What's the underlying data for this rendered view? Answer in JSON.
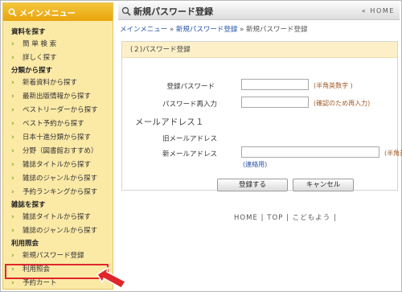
{
  "sidebar": {
    "title": "メインメニュー",
    "sections": [
      {
        "title": "資料を探す",
        "items": [
          "簡 単 検 索",
          "詳しく探す"
        ]
      },
      {
        "title": "分類から探す",
        "items": [
          "新着資料から探す",
          "最新出版情報から探す",
          "ベストリーダーから探す",
          "ベスト予約から探す",
          "日本十進分類から探す",
          "分野（図書館おすすめ）",
          "雑誌タイトルから探す",
          "雑誌のジャンルから探す",
          "予約ランキングから探す"
        ]
      },
      {
        "title": "雑誌を探す",
        "items": [
          "雑誌タイトルから探す",
          "雑誌のジャンルから探す"
        ]
      },
      {
        "title": "利用照会",
        "items": [
          "新規パスワード登録",
          "利用照会",
          "予約カート"
        ]
      }
    ]
  },
  "header": {
    "title": "新規パスワード登録",
    "home_label": "« HOME"
  },
  "breadcrumb": {
    "items": [
      "メインメニュー",
      "新規パスワード登録",
      "新規パスワード登録"
    ],
    "separator": "»"
  },
  "form": {
    "heading": "(２)パスワード登録",
    "password_label": "登録パスワード",
    "password_hint": "(半角英数字 )",
    "password_confirm_label": "パスワード再入力",
    "password_confirm_hint": "(確認のため再入力)",
    "mail_section": "メールアドレス１",
    "old_mail_label": "旧メールアドレス",
    "new_mail_label": "新メールアドレス",
    "new_mail_hint": "(半角英",
    "contact_link": "(連絡用)",
    "submit_button": "登録する",
    "cancel_button": "キャンセル"
  },
  "footer": {
    "links": [
      "HOME",
      "TOP",
      "こどもよう"
    ]
  },
  "colors": {
    "accent": "#e9a40d",
    "sidebar_bg": "#fbe9a6",
    "highlight": "#e0262c",
    "link": "#2955a8",
    "arrow": "#7ba52b"
  }
}
